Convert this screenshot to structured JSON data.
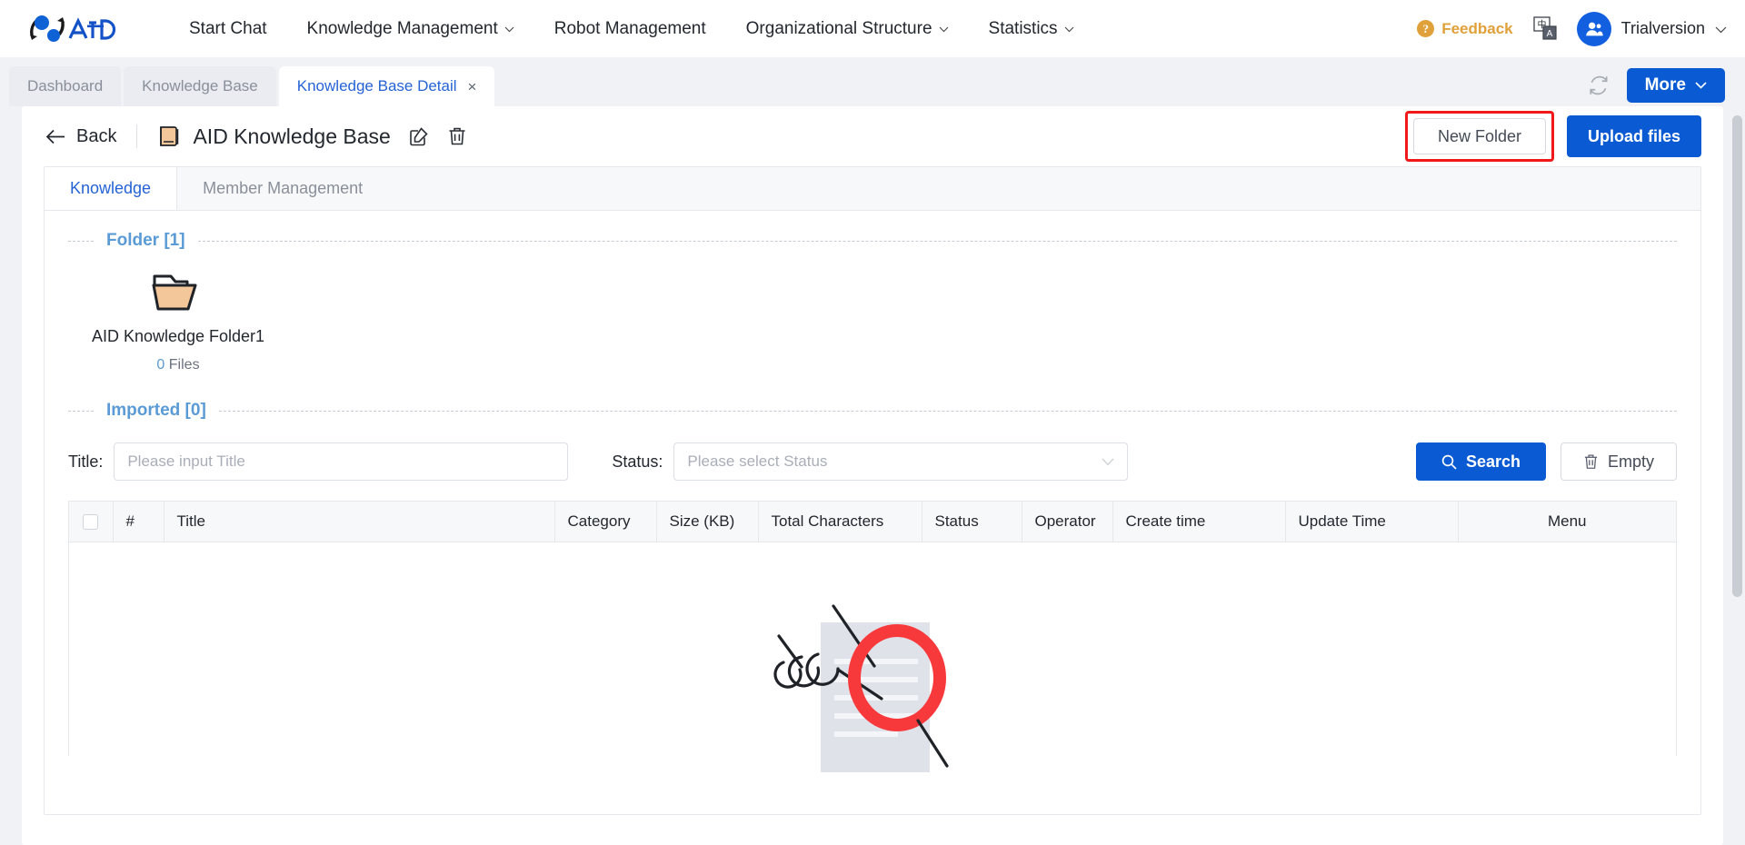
{
  "header": {
    "logo_text": "AID",
    "nav": [
      {
        "label": "Start Chat",
        "has_caret": false
      },
      {
        "label": "Knowledge Management",
        "has_caret": true
      },
      {
        "label": "Robot Management",
        "has_caret": false
      },
      {
        "label": "Organizational Structure",
        "has_caret": true
      },
      {
        "label": "Statistics",
        "has_caret": true
      }
    ],
    "feedback_label": "Feedback",
    "translate_icon": "translate-icon",
    "translate_glyphs": {
      "cn": "中",
      "en": "A"
    },
    "user_name": "Trialversion"
  },
  "tabstrip": {
    "tabs": [
      {
        "label": "Dashboard",
        "active": false,
        "closable": false
      },
      {
        "label": "Knowledge Base",
        "active": false,
        "closable": false
      },
      {
        "label": "Knowledge Base Detail",
        "active": true,
        "closable": true
      }
    ],
    "close_glyph": "×",
    "refresh_icon": "refresh-icon",
    "more_label": "More"
  },
  "page": {
    "back_label": "Back",
    "title": "AID Knowledge Base",
    "edit_icon": "edit-icon",
    "delete_icon": "trash-icon",
    "new_folder_label": "New Folder",
    "upload_files_label": "Upload files",
    "highlight_color": "#f01818"
  },
  "subtabs": [
    {
      "label": "Knowledge",
      "active": true
    },
    {
      "label": "Member Management",
      "active": false
    }
  ],
  "folder_section": {
    "label": "Folder [1]",
    "items": [
      {
        "name": "AID Knowledge Folder1",
        "count": "0",
        "count_suffix": "Files"
      }
    ]
  },
  "imported_section": {
    "label": "Imported [0]",
    "filters": {
      "title_label": "Title:",
      "title_value": "",
      "title_placeholder": "Please input Title",
      "status_label": "Status:",
      "status_value": "Please select Status",
      "status_options": [
        "Please select Status"
      ]
    },
    "search_label": "Search",
    "empty_label": "Empty",
    "search_icon": "search-icon",
    "empty_icon": "trash-icon"
  },
  "table": {
    "columns": [
      "#",
      "Title",
      "Category",
      "Size (KB)",
      "Total Characters",
      "Status",
      "Operator",
      "Create time",
      "Update Time",
      "Menu"
    ],
    "rows": [],
    "select_all_checked": false
  },
  "colors": {
    "accent_blue": "#0a5bd3",
    "link_blue": "#2563d4",
    "section_blue": "#5b9bd5",
    "feedback_orange": "#e0a03a",
    "highlight_red": "#f01818",
    "page_bg": "#f0f2f5"
  }
}
